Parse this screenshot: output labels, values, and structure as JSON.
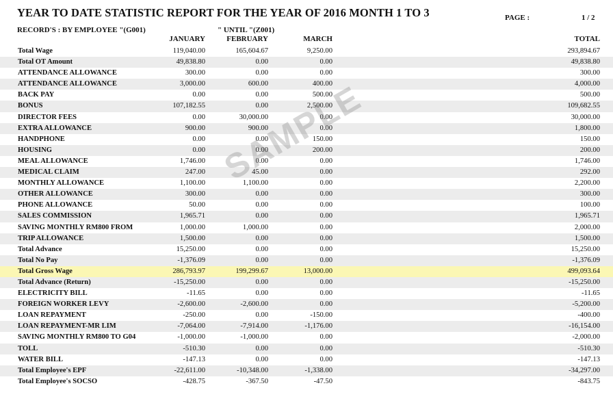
{
  "report": {
    "title": "YEAR TO DATE STATISTIC REPORT FOR THE YEAR OF 2016 MONTH 1 TO 3",
    "page_label": "PAGE :",
    "page_value": "1 / 2",
    "records_label": "RECORD'S : BY EMPLOYEE \"(G001)",
    "until_label": "\" UNTIL \"(Z001)",
    "columns": {
      "jan": "JANUARY",
      "feb": "FEBRUARY",
      "mar": "MARCH",
      "total": "TOTAL"
    },
    "watermark": "SAMPLE"
  },
  "rows": [
    {
      "label": "Total Wage",
      "jan": "119,040.00",
      "feb": "165,604.67",
      "mar": "9,250.00",
      "total": "293,894.67"
    },
    {
      "label": "Total OT Amount",
      "jan": "49,838.80",
      "feb": "0.00",
      "mar": "0.00",
      "total": "49,838.80"
    },
    {
      "label": "ATTENDANCE ALLOWANCE",
      "jan": "300.00",
      "feb": "0.00",
      "mar": "0.00",
      "total": "300.00"
    },
    {
      "label": "ATTENDANCE ALLOWANCE",
      "jan": "3,000.00",
      "feb": "600.00",
      "mar": "400.00",
      "total": "4,000.00"
    },
    {
      "label": "BACK PAY",
      "jan": "0.00",
      "feb": "0.00",
      "mar": "500.00",
      "total": "500.00"
    },
    {
      "label": "BONUS",
      "jan": "107,182.55",
      "feb": "0.00",
      "mar": "2,500.00",
      "total": "109,682.55"
    },
    {
      "label": "DIRECTOR FEES",
      "jan": "0.00",
      "feb": "30,000.00",
      "mar": "0.00",
      "total": "30,000.00"
    },
    {
      "label": "EXTRA ALLOWANCE",
      "jan": "900.00",
      "feb": "900.00",
      "mar": "0.00",
      "total": "1,800.00"
    },
    {
      "label": "HANDPHONE",
      "jan": "0.00",
      "feb": "0.00",
      "mar": "150.00",
      "total": "150.00"
    },
    {
      "label": "HOUSING",
      "jan": "0.00",
      "feb": "0.00",
      "mar": "200.00",
      "total": "200.00"
    },
    {
      "label": "MEAL ALLOWANCE",
      "jan": "1,746.00",
      "feb": "0.00",
      "mar": "0.00",
      "total": "1,746.00"
    },
    {
      "label": "MEDICAL CLAIM",
      "jan": "247.00",
      "feb": "45.00",
      "mar": "0.00",
      "total": "292.00"
    },
    {
      "label": "MONTHLY ALLOWANCE",
      "jan": "1,100.00",
      "feb": "1,100.00",
      "mar": "0.00",
      "total": "2,200.00"
    },
    {
      "label": "OTHER ALLOWANCE",
      "jan": "300.00",
      "feb": "0.00",
      "mar": "0.00",
      "total": "300.00"
    },
    {
      "label": "PHONE ALLOWANCE",
      "jan": "50.00",
      "feb": "0.00",
      "mar": "0.00",
      "total": "100.00"
    },
    {
      "label": "SALES COMMISSION",
      "jan": "1,965.71",
      "feb": "0.00",
      "mar": "0.00",
      "total": "1,965.71"
    },
    {
      "label": "SAVING MONTHLY RM800 FROM",
      "jan": "1,000.00",
      "feb": "1,000.00",
      "mar": "0.00",
      "total": "2,000.00"
    },
    {
      "label": "TRIP ALLOWANCE",
      "jan": "1,500.00",
      "feb": "0.00",
      "mar": "0.00",
      "total": "1,500.00"
    },
    {
      "label": "Total Advance",
      "jan": "15,250.00",
      "feb": "0.00",
      "mar": "0.00",
      "total": "15,250.00"
    },
    {
      "label": "Total No Pay",
      "jan": "-1,376.09",
      "feb": "0.00",
      "mar": "0.00",
      "total": "-1,376.09"
    },
    {
      "label": "Total Gross Wage",
      "jan": "286,793.97",
      "feb": "199,299.67",
      "mar": "13,000.00",
      "total": "499,093.64",
      "highlight": true
    },
    {
      "label": "Total Advance (Return)",
      "jan": "-15,250.00",
      "feb": "0.00",
      "mar": "0.00",
      "total": "-15,250.00"
    },
    {
      "label": "ELECTRICITY BILL",
      "jan": "-11.65",
      "feb": "0.00",
      "mar": "0.00",
      "total": "-11.65"
    },
    {
      "label": "FOREIGN WORKER LEVY",
      "jan": "-2,600.00",
      "feb": "-2,600.00",
      "mar": "0.00",
      "total": "-5,200.00"
    },
    {
      "label": "LOAN REPAYMENT",
      "jan": "-250.00",
      "feb": "0.00",
      "mar": "-150.00",
      "total": "-400.00"
    },
    {
      "label": "LOAN REPAYMENT-MR LIM",
      "jan": "-7,064.00",
      "feb": "-7,914.00",
      "mar": "-1,176.00",
      "total": "-16,154.00"
    },
    {
      "label": "SAVING MONTHLY RM800 TO G04",
      "jan": "-1,000.00",
      "feb": "-1,000.00",
      "mar": "0.00",
      "total": "-2,000.00"
    },
    {
      "label": "TOLL",
      "jan": "-510.30",
      "feb": "0.00",
      "mar": "0.00",
      "total": "-510.30"
    },
    {
      "label": "WATER BILL",
      "jan": "-147.13",
      "feb": "0.00",
      "mar": "0.00",
      "total": "-147.13"
    },
    {
      "label": "Total Employee's EPF",
      "jan": "-22,611.00",
      "feb": "-10,348.00",
      "mar": "-1,338.00",
      "total": "-34,297.00"
    },
    {
      "label": "Total Employee's SOCSO",
      "jan": "-428.75",
      "feb": "-367.50",
      "mar": "-47.50",
      "total": "-843.75"
    }
  ]
}
